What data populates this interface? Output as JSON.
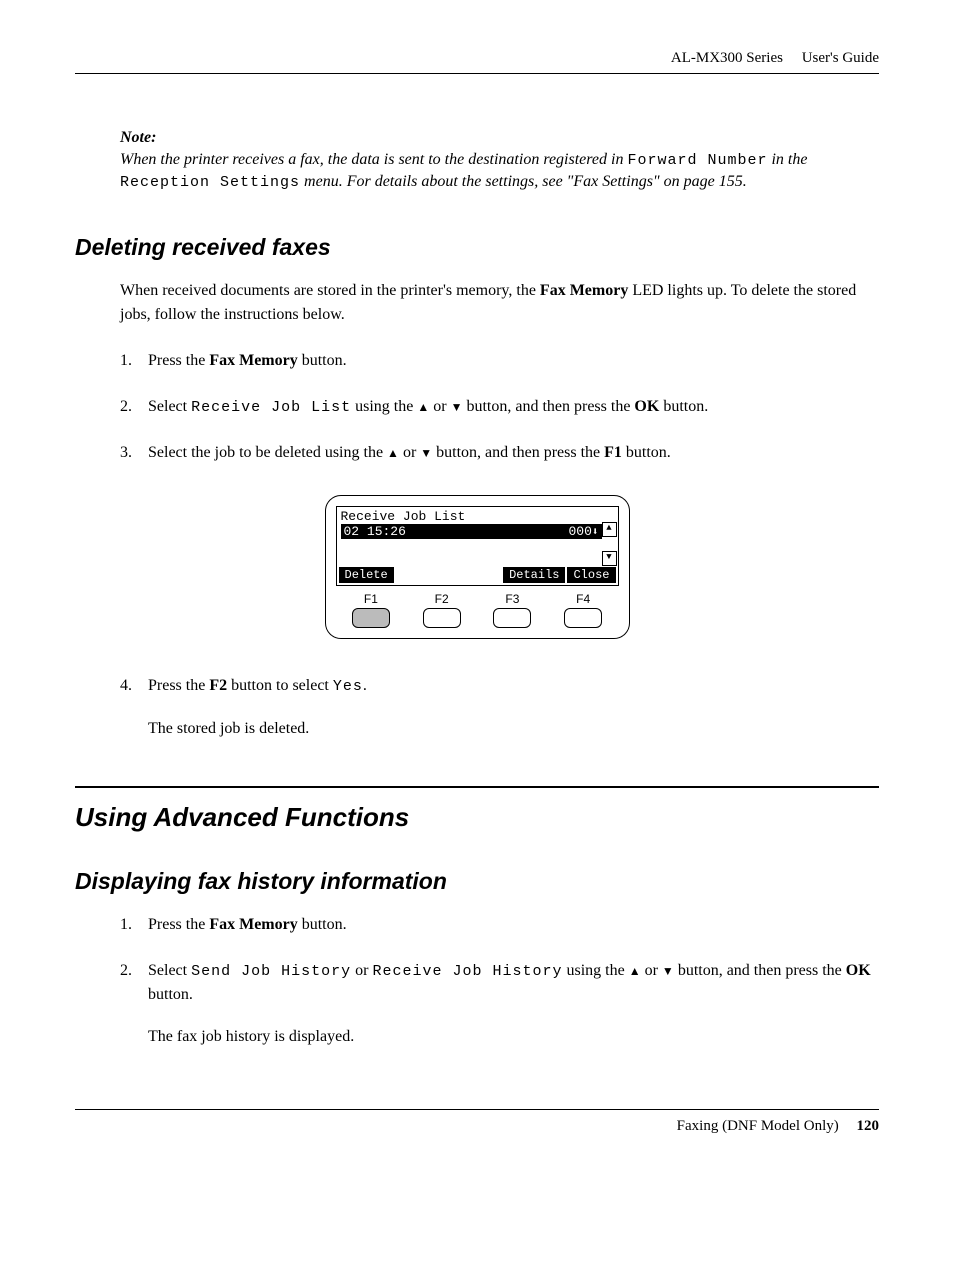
{
  "header": {
    "series": "AL-MX300 Series",
    "guide": "User's Guide"
  },
  "note": {
    "label": "Note:",
    "pre": "When the printer receives a fax, the data is sent to the destination registered in ",
    "mono1": "Forward Number",
    "mid": " in the ",
    "mono2": "Reception Settings",
    "post": " menu. For details about the settings, see \"Fax Settings\" on page 155."
  },
  "section1": {
    "title": "Deleting received faxes",
    "intro_pre": "When received documents are stored in the printer's memory, the ",
    "intro_bold": "Fax Memory",
    "intro_post": " LED lights up. To delete the stored jobs, follow the instructions below.",
    "step1_num": "1.",
    "step1_pre": "Press the ",
    "step1_bold": "Fax Memory",
    "step1_post": " button.",
    "step2_num": "2.",
    "step2_pre": "Select ",
    "step2_mono": "Receive Job List",
    "step2_mid": " using the ",
    "step2_mid2": " or ",
    "step2_mid3": " button, and then press the ",
    "step2_bold": "OK",
    "step2_post": " button.",
    "step3_num": "3.",
    "step3_pre": "Select the job to be deleted using the ",
    "step3_mid": " or ",
    "step3_mid2": " button, and then press the ",
    "step3_bold": "F1",
    "step3_post": " button.",
    "step4_num": "4.",
    "step4_pre": "Press the ",
    "step4_bold": "F2",
    "step4_mid": " button to select ",
    "step4_mono": "Yes",
    "step4_post": ".",
    "step4_result": "The stored job is deleted."
  },
  "figure": {
    "lcd_title": "Receive Job List",
    "lcd_row2_left": "02 15:26",
    "lcd_row2_right": "000",
    "btn_delete": "Delete",
    "btn_details": "Details",
    "btn_close": "Close",
    "f1": "F1",
    "f2": "F2",
    "f3": "F3",
    "f4": "F4"
  },
  "section2": {
    "title": "Using Advanced Functions"
  },
  "section3": {
    "title": "Displaying fax history information",
    "step1_num": "1.",
    "step1_pre": "Press the ",
    "step1_bold": "Fax Memory",
    "step1_post": " button.",
    "step2_num": "2.",
    "step2_pre": "Select ",
    "step2_mono1": "Send Job History",
    "step2_mid1": " or ",
    "step2_mono2": "Receive Job History",
    "step2_mid2": " using the ",
    "step2_mid3": " or ",
    "step2_mid4": " button, and then press the ",
    "step2_bold": "OK",
    "step2_post": " button.",
    "result": "The fax job history is displayed."
  },
  "footer": {
    "chapter": "Faxing (DNF Model Only)",
    "page": "120"
  }
}
